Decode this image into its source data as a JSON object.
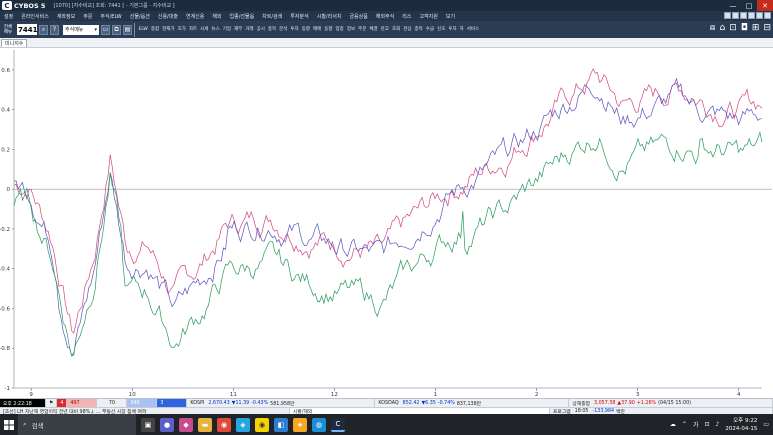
{
  "titlebar": {
    "app_name": "CYBOS 5",
    "info": "[1070] [지수비교] 조회: 7441 [ - 기본그룹 - 지수비교 ]",
    "minimize": "—",
    "maximize": "□",
    "close": "✕"
  },
  "menu": [
    "설정",
    "온라인서비스",
    "계좌정보",
    "주문",
    "주식/ELW",
    "선물/옵션",
    "신용/대출",
    "연계신용",
    "해외",
    "업종/선물옵",
    "차트/검색",
    "투자분석",
    "시황/리서치",
    "금융상품",
    "해외주식",
    "리스",
    "고객지원",
    "보기"
  ],
  "toolbar": {
    "label_1": "전체",
    "label_2": "메뉴",
    "code_value": "7441",
    "combo_value": "주식메뉴",
    "buttons": [
      "ELW",
      "종합",
      "현재가",
      "호가",
      "차트",
      "시세",
      "뉴스",
      "기업",
      "재무",
      "거래",
      "공시",
      "종목",
      "분석",
      "투자",
      "동향",
      "매매",
      "동향",
      "업종",
      "정보",
      "주문",
      "체결",
      "잔고",
      "조회",
      "관심",
      "종목",
      "수급",
      "신호",
      "투자",
      "자",
      "서비스"
    ],
    "right_icons": [
      "monitor-icon",
      "home-icon",
      "layout-icon",
      "camera-icon",
      "windows-icon",
      "grid-icon"
    ]
  },
  "tab": {
    "label": "미니지수"
  },
  "chart_data": {
    "type": "line",
    "y_ticks": [
      "0.6",
      "0.4",
      "0.2",
      "0",
      "-0.2",
      "-0.4",
      "-0.6",
      "-0.8",
      "-1"
    ],
    "ylim": [
      -1.0,
      0.7
    ],
    "x_ticks": [
      "9",
      "10",
      "11",
      "12",
      "1",
      "2",
      "3",
      "4"
    ],
    "xlim": [
      0,
      700
    ],
    "gridline": "zero",
    "series": [
      {
        "color": "#d2477f"
      },
      {
        "color": "#5a56c0"
      },
      {
        "color": "#269a5c"
      }
    ]
  },
  "statusbar": {
    "row1": {
      "time": "오후 2:22:18",
      "cell_red": "4",
      "cell_pink": "497",
      "cell_num": "70",
      "cell_lblue": "346",
      "cell_blue": "3",
      "kospi_label": "KOSPI",
      "kospi_value": "2,670.43",
      "kospi_change": "▼11.39",
      "kospi_pct": "-0.43%",
      "kospi_volume": "581,958만",
      "kosdaq_label": "KOSDAQ",
      "kosdaq_value": "852.42",
      "kosdaq_change": "▼6.35",
      "kosdaq_pct": "-0.74%",
      "kosdaq_volume": "837,138만",
      "world_label": "상해종합",
      "world_value": "3,057.38",
      "world_change": "▲37.90",
      "world_pct": "+1.26%",
      "world_time": "(04/15 15:00)"
    },
    "row2": {
      "news": "[조선] LH 지난해 영업이익 전년 대비 98%↓ … 부동산 시장 침체 여파",
      "search_placeholder": "시황/해외",
      "program_label": "프로그램",
      "program_value": "18:05",
      "program_amount": "-133,984",
      "program_unit": "백만"
    }
  },
  "taskbar": {
    "search_text": "검색",
    "tray_text": "가",
    "clock_time": "오후 9:22",
    "clock_date": "2024-04-15"
  }
}
